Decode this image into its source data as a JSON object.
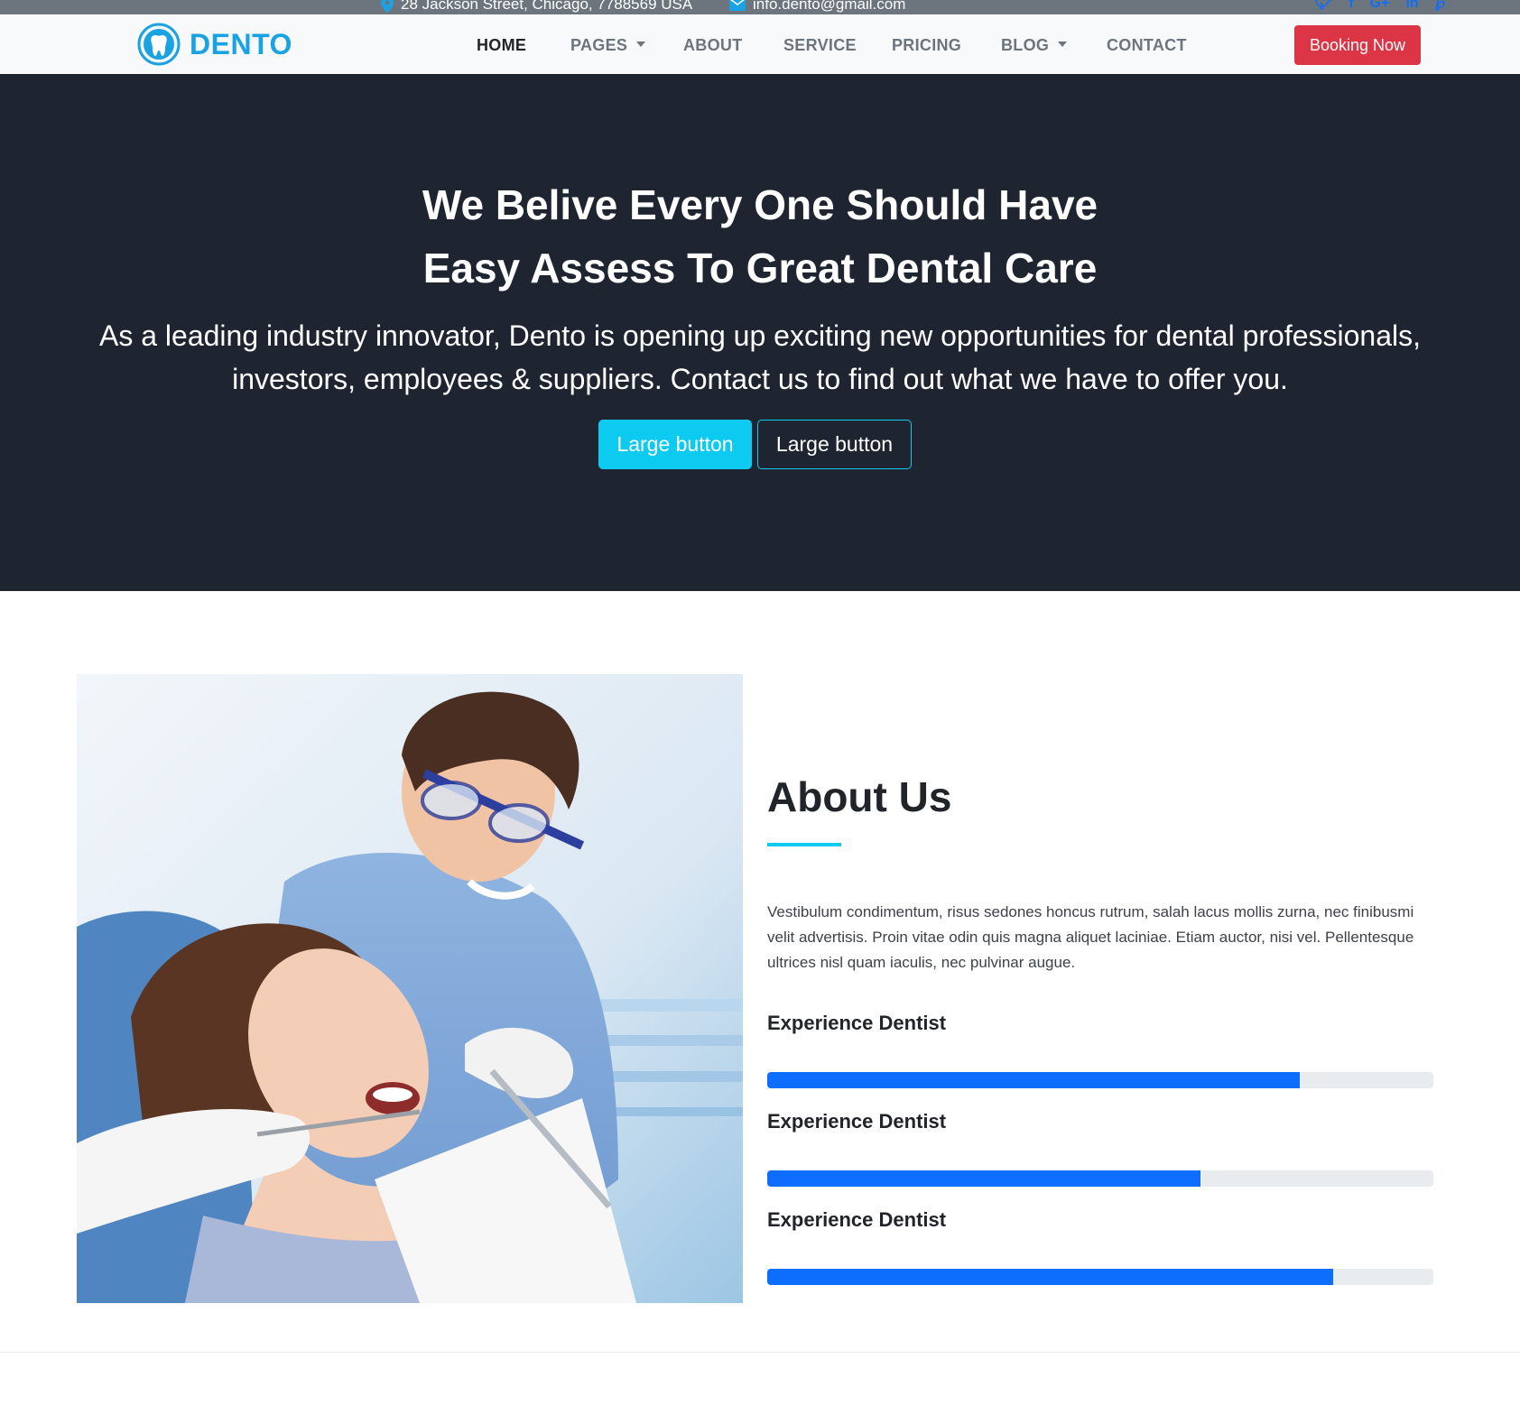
{
  "topbar": {
    "address": "28 Jackson Street, Chicago, 7788569 USA",
    "email": "info.dento@gmail.com",
    "social": [
      "twitter-icon",
      "facebook-icon",
      "google-plus-icon",
      "linkedin-icon",
      "pinterest-icon"
    ]
  },
  "brand": {
    "name": "DENTO",
    "color": "#1aa3e2"
  },
  "nav": {
    "home": "HOME",
    "pages": "PAGES",
    "about": "ABOUT",
    "service": "SERVICE",
    "pricing": "PRICING",
    "blog": "BLOG",
    "contact": "CONTACT",
    "booking": "Booking Now"
  },
  "hero": {
    "title_line1": "We Belive Every One Should Have",
    "title_line2": "Easy Assess To Great Dental Care",
    "subtitle_line1": "As a leading industry innovator, Dento is opening up exciting new opportunities for dental professionals,",
    "subtitle_line2": "investors, employees & suppliers. Contact us to find out what we have to offer you.",
    "primary_button": "Large button",
    "secondary_button": "Large button"
  },
  "about": {
    "title": "About Us",
    "text": "Vestibulum condimentum, risus sedones honcus rutrum, salah lacus mollis zurna, nec finibusmi velit advertisis. Proin vitae odin quis magna aliquet laciniae. Etiam auctor, nisi vel. Pellentesque ultrices nisl quam iaculis, nec pulvinar augue.",
    "skills": [
      {
        "label": "Experience Dentist",
        "percent": 80
      },
      {
        "label": "Experience Dentist",
        "percent": 65
      },
      {
        "label": "Experience Dentist",
        "percent": 85
      }
    ]
  },
  "colors": {
    "hero_bg": "#1e2530",
    "accent": "#0dcaf0",
    "progress": "#0d6efd",
    "booking": "#dc3545"
  }
}
